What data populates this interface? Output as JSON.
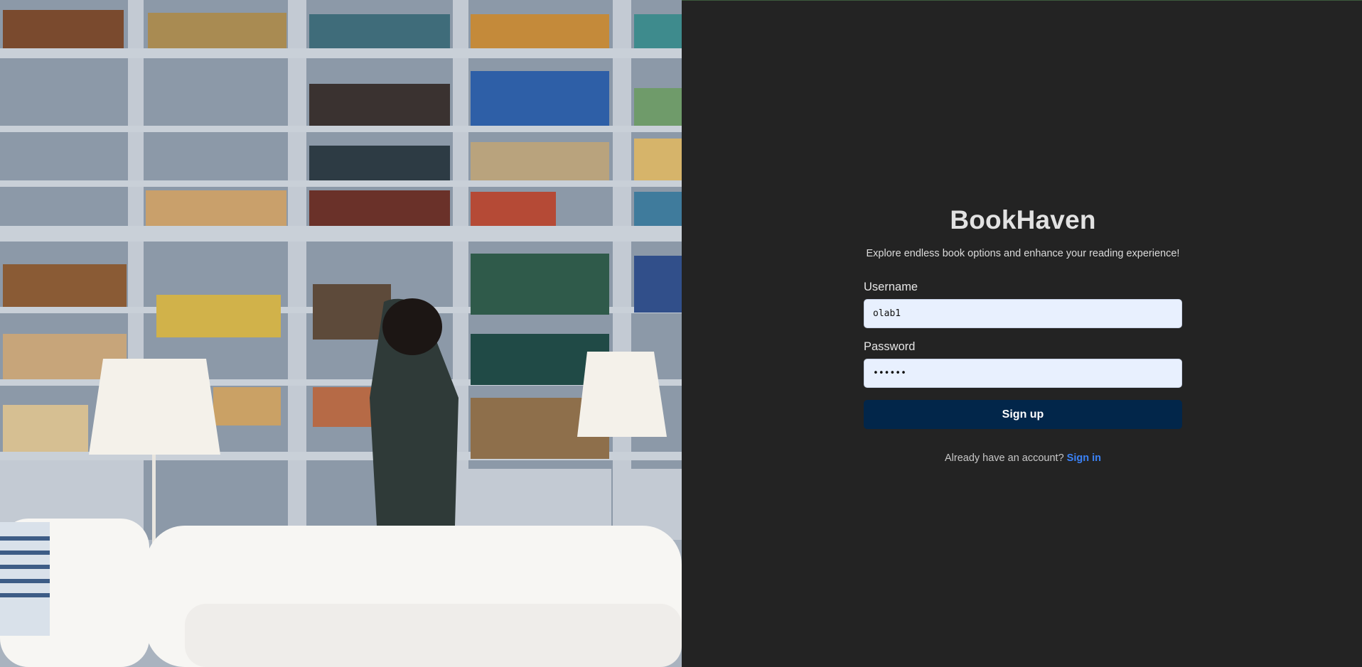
{
  "brand": {
    "title": "BookHaven",
    "tagline": "Explore endless book options and enhance your reading experience!"
  },
  "form": {
    "username_label": "Username",
    "username_value": "olab1",
    "password_label": "Password",
    "password_value": "••••••",
    "submit_label": "Sign up"
  },
  "footer": {
    "prompt": "Already have an account?",
    "link_label": "Sign in"
  },
  "colors": {
    "panel_bg": "#232323",
    "button_bg": "#02264a",
    "input_bg": "#e8f0fe",
    "link": "#3b82f6"
  },
  "hero_image": {
    "icon": "bookshelf-photo"
  }
}
